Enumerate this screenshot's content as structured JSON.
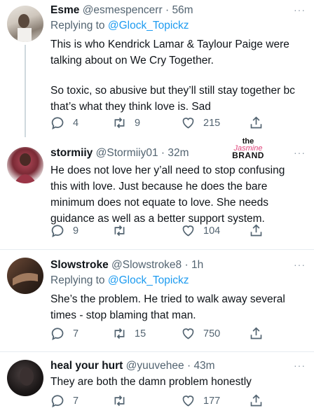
{
  "tweets": [
    {
      "name": "Esme",
      "handle": "@esmespencerr",
      "time": "56m",
      "reply_prefix": "Replying to",
      "reply_to": "@Glock_Topickz",
      "paragraphs": [
        "This is who Kendrick Lamar & Taylour Paige were talking about on We Cry Together.",
        "So toxic, so abusive but they’ll still stay together bc that’s what they think love is. Sad"
      ],
      "replies": "4",
      "retweets": "9",
      "likes": "215"
    },
    {
      "name": "stormiiy",
      "handle": "@Stormiiy01",
      "time": "32m",
      "paragraphs": [
        "He does not love her y’all need to stop confusing this with love. Just because he does the bare minimum does not equate to love. She needs guidance as well as a better support system."
      ],
      "replies": "9",
      "retweets": "",
      "likes": "104"
    },
    {
      "name": "Slowstroke",
      "handle": "@Slowstroke8",
      "time": "1h",
      "reply_prefix": "Replying to",
      "reply_to": "@Glock_Topickz",
      "paragraphs": [
        "She’s the problem. He tried to walk away several times - stop blaming that man."
      ],
      "replies": "7",
      "retweets": "15",
      "likes": "750"
    },
    {
      "name": "heal your hurt",
      "handle": "@yuuvehee",
      "time": "43m",
      "paragraphs": [
        "They are both the damn problem honestly"
      ],
      "replies": "7",
      "retweets": "",
      "likes": "177"
    }
  ],
  "separator": "·",
  "more_icon": "···",
  "watermark": {
    "line1": "the",
    "line2": "Jasmine",
    "line3": "BRAND"
  },
  "colors": {
    "link": "#1d9bf0",
    "muted": "#536471",
    "text": "#0f1419"
  }
}
